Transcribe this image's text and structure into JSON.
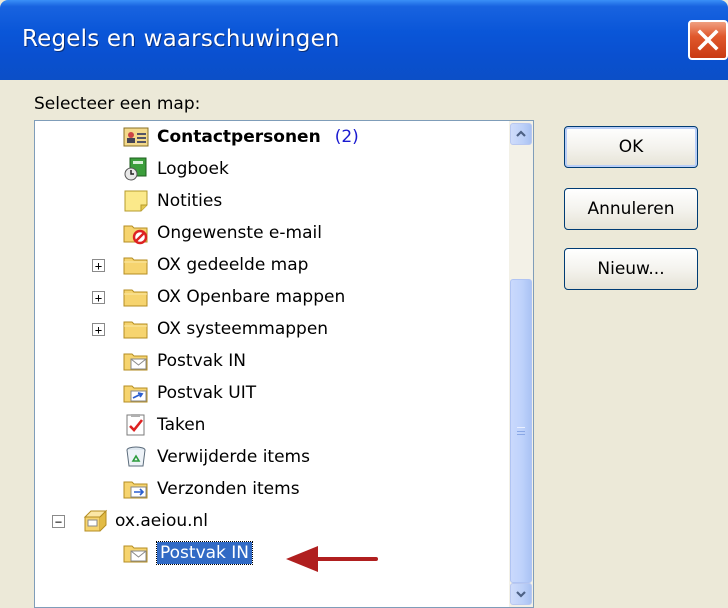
{
  "window": {
    "title": "Regels en waarschuwingen"
  },
  "prompt": "Selecteer een map:",
  "buttons": {
    "ok": "OK",
    "cancel": "Annuleren",
    "new": "Nieuw..."
  },
  "tree": {
    "items": [
      {
        "label": "Contactpersonen",
        "count": "(2)",
        "icon": "contacts-icon"
      },
      {
        "label": "Logboek",
        "icon": "journal-icon"
      },
      {
        "label": "Notities",
        "icon": "notes-icon"
      },
      {
        "label": "Ongewenste e-mail",
        "icon": "junk-mail-folder-icon"
      },
      {
        "label": "OX gedeelde map",
        "icon": "folder-icon",
        "expander": "+"
      },
      {
        "label": "OX Openbare mappen",
        "icon": "folder-icon",
        "expander": "+"
      },
      {
        "label": "OX systeemmappen",
        "icon": "folder-icon",
        "expander": "+"
      },
      {
        "label": "Postvak IN",
        "icon": "inbox-folder-icon"
      },
      {
        "label": "Postvak UIT",
        "icon": "outbox-folder-icon"
      },
      {
        "label": "Taken",
        "icon": "tasks-icon"
      },
      {
        "label": "Verwijderde items",
        "icon": "deleted-items-icon"
      },
      {
        "label": "Verzonden items",
        "icon": "sent-items-icon"
      },
      {
        "label": "ox.aeiou.nl",
        "icon": "mailbox-root-icon",
        "expander": "−"
      },
      {
        "label": "Postvak IN",
        "icon": "inbox-folder-icon",
        "selected": true
      }
    ]
  },
  "colors": {
    "titlebar": "#0a56d8",
    "selection": "#316ac5",
    "arrow": "#b01f1f",
    "count": "#1a1ad0"
  }
}
